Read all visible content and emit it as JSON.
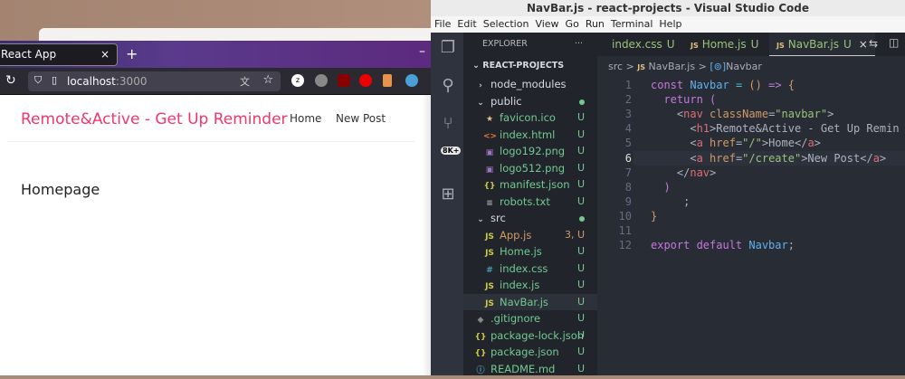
{
  "browser": {
    "tab_title": "React App",
    "tab_close": "×",
    "new_tab": "+",
    "minimize": "–",
    "url_host": "localhost",
    "url_port": ":3000",
    "page": {
      "brand": "Remote&Active - Get Up Reminder",
      "nav_links": [
        "Home",
        "New Post"
      ],
      "heading": "Homepage"
    },
    "brand_color": "#f1356d"
  },
  "vscode": {
    "title": "NavBar.js - react-projects - Visual Studio Code",
    "menu": [
      "File",
      "Edit",
      "Selection",
      "View",
      "Go",
      "Run",
      "Terminal",
      "Help"
    ],
    "source_control_badge": "8K+",
    "explorer": {
      "header": "EXPLORER",
      "more": "···",
      "root": "REACT-PROJECTS",
      "items": [
        {
          "name": "node_modules",
          "depth": 0,
          "type": "folder-closed",
          "status": ""
        },
        {
          "name": "public",
          "depth": 0,
          "type": "folder-open",
          "status": "dot"
        },
        {
          "name": "favicon.ico",
          "depth": 1,
          "type": "star",
          "status": "U"
        },
        {
          "name": "index.html",
          "depth": 1,
          "type": "html",
          "status": "U"
        },
        {
          "name": "logo192.png",
          "depth": 1,
          "type": "image",
          "status": "U"
        },
        {
          "name": "logo512.png",
          "depth": 1,
          "type": "image",
          "status": "U"
        },
        {
          "name": "manifest.json",
          "depth": 1,
          "type": "json",
          "status": "U"
        },
        {
          "name": "robots.txt",
          "depth": 1,
          "type": "text",
          "status": "U"
        },
        {
          "name": "src",
          "depth": 0,
          "type": "folder-open",
          "status": "dot"
        },
        {
          "name": "App.js",
          "depth": 1,
          "type": "js",
          "status": "3, U"
        },
        {
          "name": "Home.js",
          "depth": 1,
          "type": "js",
          "status": "U"
        },
        {
          "name": "index.css",
          "depth": 1,
          "type": "css",
          "status": "U"
        },
        {
          "name": "index.js",
          "depth": 1,
          "type": "js",
          "status": "U"
        },
        {
          "name": "NavBar.js",
          "depth": 1,
          "type": "js",
          "status": "U",
          "selected": true
        },
        {
          "name": ".gitignore",
          "depth": 0,
          "type": "git",
          "status": "U"
        },
        {
          "name": "package-lock.json",
          "depth": 0,
          "type": "json",
          "status": "U"
        },
        {
          "name": "package.json",
          "depth": 0,
          "type": "json",
          "status": "U"
        },
        {
          "name": "README.md",
          "depth": 0,
          "type": "info",
          "status": "U"
        }
      ]
    },
    "tabs": [
      {
        "name": "index.css",
        "status": "U",
        "icon": ""
      },
      {
        "name": "Home.js",
        "status": "U",
        "icon": "JS"
      },
      {
        "name": "NavBar.js",
        "status": "U",
        "icon": "JS",
        "active": true,
        "close": "×"
      }
    ],
    "breadcrumb": {
      "folder": "src",
      "file": "NavBar.js",
      "symbol": "Navbar",
      "sep": ">",
      "js": "JS"
    },
    "current_line": 6,
    "code": [
      [
        [
          "const ",
          "kw"
        ],
        [
          "Navbar",
          "fn"
        ],
        [
          " = ",
          "op"
        ],
        [
          "() ",
          "br"
        ],
        [
          "=> ",
          "kw"
        ],
        [
          "{",
          "br"
        ]
      ],
      [
        [
          "  return ",
          "kw"
        ],
        [
          "(",
          "kw"
        ]
      ],
      [
        [
          "    <",
          ""
        ],
        [
          "nav ",
          "tg"
        ],
        [
          "className",
          "at"
        ],
        [
          "=",
          ""
        ],
        [
          "\"navbar\"",
          "str"
        ],
        [
          ">",
          ""
        ]
      ],
      [
        [
          "      <",
          ""
        ],
        [
          "h1",
          "tg"
        ],
        [
          ">Remote&Active - Get Up Remin",
          ""
        ]
      ],
      [
        [
          "      <",
          ""
        ],
        [
          "a ",
          "tg"
        ],
        [
          "href",
          "at"
        ],
        [
          "=",
          ""
        ],
        [
          "\"/\"",
          "str"
        ],
        [
          ">Home</",
          ""
        ],
        [
          "a",
          "tg"
        ],
        [
          ">",
          ""
        ]
      ],
      [
        [
          "      <",
          ""
        ],
        [
          "a ",
          "tg"
        ],
        [
          "href",
          "at"
        ],
        [
          "=",
          ""
        ],
        [
          "\"/create\"",
          "str"
        ],
        [
          ">New Post</",
          ""
        ],
        [
          "a",
          "tg"
        ],
        [
          ">",
          ""
        ]
      ],
      [
        [
          "    </",
          ""
        ],
        [
          "nav",
          "tg"
        ],
        [
          ">",
          ""
        ]
      ],
      [
        [
          "  )",
          "kw"
        ]
      ],
      [
        [
          "     ;",
          ""
        ]
      ],
      [
        [
          "}",
          "br"
        ]
      ],
      [],
      [
        [
          "export ",
          "kw"
        ],
        [
          "default ",
          "kw"
        ],
        [
          "Navbar",
          "fn"
        ],
        [
          ";",
          ""
        ]
      ]
    ]
  }
}
